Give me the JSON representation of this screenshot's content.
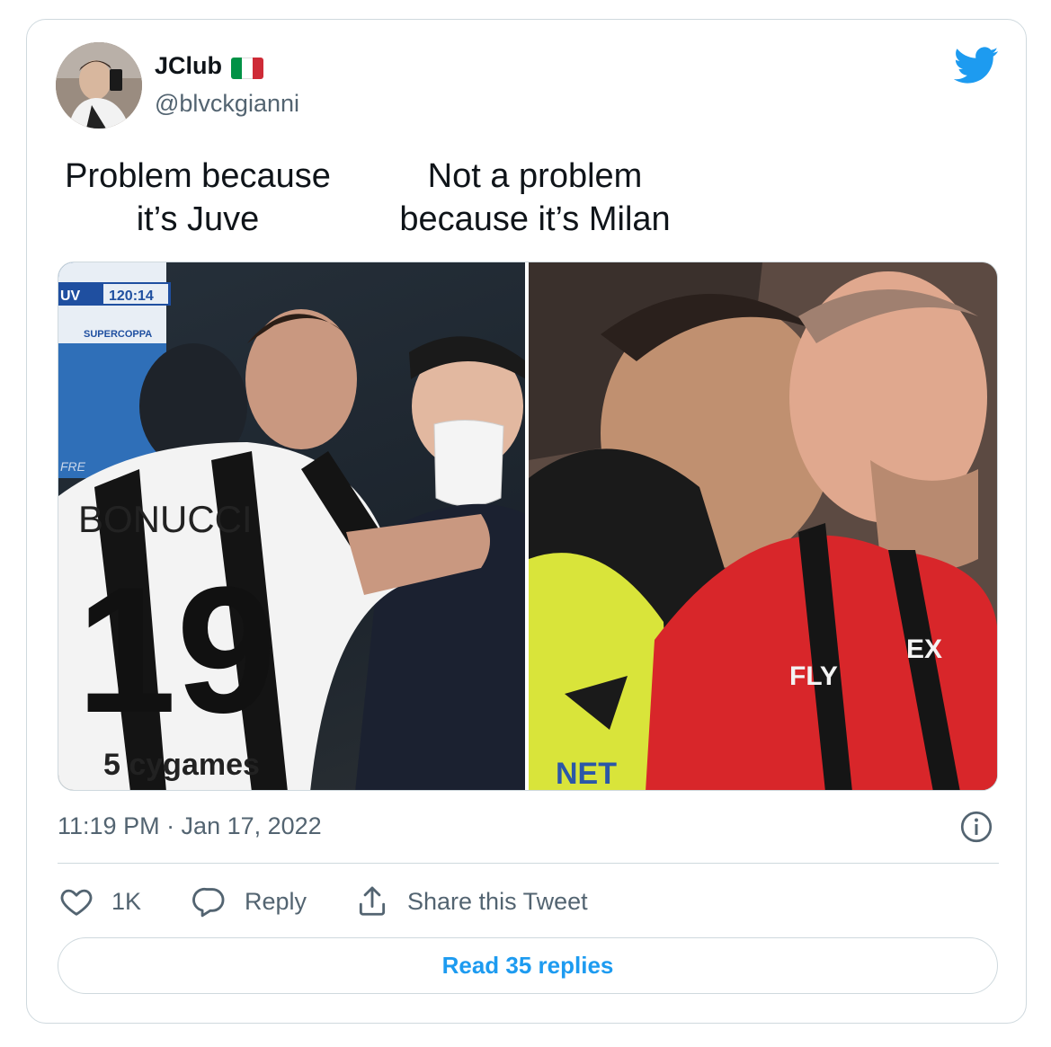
{
  "tweet": {
    "display_name": "JClub",
    "handle": "@blvckgianni",
    "caption_left": [
      "Problem because",
      "it’s Juve"
    ],
    "caption_right": [
      "Not a problem",
      "because it’s Milan"
    ],
    "timestamp": "11:19 PM · Jan 17, 2022",
    "colors": {
      "accent": "#1d9bf0",
      "muted": "#536471",
      "border": "#cfd9de"
    },
    "flag_colors": [
      "#009246",
      "#ffffff",
      "#ce2b37"
    ]
  },
  "media": {
    "left": {
      "score_team": "UV",
      "score_time": "120:14",
      "banner_text": "SUPERCOPPA",
      "banner_text_side": "FRE",
      "jersey_name": "BONUCCI",
      "jersey_number": "19",
      "sponsor": "5 cygames"
    },
    "right": {
      "text_sleeve": "NET",
      "text_shirt": "EX",
      "text_shirt_2": "FLY"
    }
  },
  "actions": {
    "like_count": "1K",
    "reply_label": "Reply",
    "share_label": "Share this Tweet",
    "icons": [
      "heart-icon",
      "reply-icon",
      "share-icon",
      "info-icon",
      "twitter-bird-icon"
    ]
  },
  "read_replies": "Read 35 replies"
}
